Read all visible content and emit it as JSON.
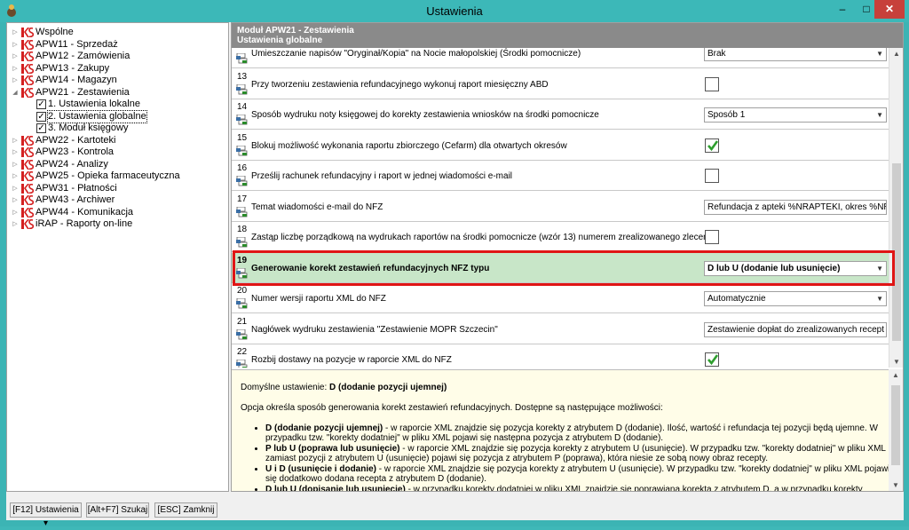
{
  "window": {
    "title": "Ustawienia",
    "minimize": "–",
    "maximize": "□",
    "close": "✕"
  },
  "tree": {
    "items": [
      {
        "label": "Wspólne",
        "type": "ks",
        "expanded": false
      },
      {
        "label": "APW11 - Sprzedaż",
        "type": "ks",
        "expanded": false
      },
      {
        "label": "APW12 - Zamówienia",
        "type": "ks",
        "expanded": false
      },
      {
        "label": "APW13 - Zakupy",
        "type": "ks",
        "expanded": false
      },
      {
        "label": "APW14 - Magazyn",
        "type": "ks",
        "expanded": false
      },
      {
        "label": "APW21 - Zestawienia",
        "type": "ks",
        "expanded": true
      },
      {
        "label": "1. Ustawienia lokalne",
        "type": "chk",
        "child": true
      },
      {
        "label": "2. Ustawienia globalne",
        "type": "chk",
        "child": true,
        "selected": true
      },
      {
        "label": "3. Moduł księgowy",
        "type": "chk",
        "child": true
      },
      {
        "label": "APW22 - Kartoteki",
        "type": "ks",
        "expanded": false
      },
      {
        "label": "APW23 - Kontrola",
        "type": "ks",
        "expanded": false
      },
      {
        "label": "APW24 - Analizy",
        "type": "ks",
        "expanded": false
      },
      {
        "label": "APW25 - Opieka farmaceutyczna",
        "type": "ks",
        "expanded": false
      },
      {
        "label": "APW31 - Płatności",
        "type": "ks",
        "expanded": false
      },
      {
        "label": "APW43 - Archiwer",
        "type": "ks",
        "expanded": false
      },
      {
        "label": "APW44 - Komunikacja",
        "type": "ks",
        "expanded": false
      },
      {
        "label": "iRAP - Raporty on-line",
        "type": "ks",
        "expanded": false
      }
    ]
  },
  "header": {
    "module": "Moduł APW21 - Zestawienia",
    "section": "Ustawienia globalne"
  },
  "rows": [
    {
      "num": "",
      "label": "Umieszczanie napisów \"Oryginał/Kopia\" na Nocie małopolskiej (Środki pomocnicze)",
      "control": "select",
      "value": "Brak"
    },
    {
      "num": "13",
      "label": "Przy tworzeniu zestawienia refundacyjnego wykonuj raport miesięczny ABD",
      "control": "checkbox",
      "checked": false
    },
    {
      "num": "14",
      "label": "Sposób wydruku noty księgowej do korekty zestawienia wniosków na środki pomocnicze",
      "control": "select",
      "value": "Sposób 1"
    },
    {
      "num": "15",
      "label": "Blokuj możliwość wykonania raportu zbiorczego (Cefarm) dla otwartych okresów",
      "control": "checkbox",
      "checked": true
    },
    {
      "num": "16",
      "label": "Prześlij rachunek refundacyjny i raport w jednej wiadomości e-mail",
      "control": "checkbox",
      "checked": false
    },
    {
      "num": "17",
      "label": "Temat wiadomości e-mail do NFZ",
      "control": "text",
      "value": "Refundacja z apteki %NRAPTEKI, okres %NROKRES"
    },
    {
      "num": "18",
      "label": "Zastąp liczbę porządkową na wydrukach raportów na środki pomocnicze (wzór 13) numerem zrealizowanego zlecenia",
      "control": "checkbox",
      "checked": false
    },
    {
      "num": "19",
      "label": "Generowanie korekt zestawień refundacyjnych NFZ typu",
      "control": "select",
      "value": "D lub U (dodanie lub usunięcie)",
      "highlight": true
    },
    {
      "num": "20",
      "label": "Numer wersji raportu XML do NFZ",
      "control": "select",
      "value": "Automatycznie"
    },
    {
      "num": "21",
      "label": "Nagłówek wydruku zestawienia \"Zestawienie MOPR Szczecin\"",
      "control": "text",
      "value": "Zestawienie dopłat do zrealizowanych recept dla pe"
    },
    {
      "num": "22",
      "label": "Rozbij dostawy na pozycje w raporcie XML do NFZ",
      "control": "checkbox",
      "checked": true
    }
  ],
  "description": {
    "default_prefix": "Domyślne ustawienie: ",
    "default_value": "D (dodanie pozycji ujemnej)",
    "intro": "Opcja określa sposób generowania korekt zestawień refundacyjnych. Dostępne są następujące możliwości:",
    "options": [
      {
        "term": "D (dodanie pozycji ujemnej)",
        "text": " - w raporcie XML znajdzie się pozycja korekty z atrybutem D (dodanie). Ilość, wartość i refundacja tej pozycji będą ujemne. W przypadku tzw. \"korekty dodatniej\" w pliku XML pojawi się następna pozycja z atrybutem D (dodanie)."
      },
      {
        "term": "P lub U (poprawa lub usunięcie)",
        "text": " - w raporcie XML znajdzie się pozycja korekty z atrybutem U (usunięcie). W przypadku tzw. \"korekty dodatniej\" w pliku XML zamiast pozycji z atrybutem U (usunięcie) pojawi się pozycja z atrybutem P (poprawa), która niesie ze sobą nowy obraz recepty."
      },
      {
        "term": "U i D (usunięcie i dodanie)",
        "text": " - w raporcie XML znajdzie się pozycja korekty z atrybutem U (usunięcie). W przypadku tzw. \"korekty dodatniej\" w pliku XML pojawi się dodatkowo dodana recepta z atrybutem D (dodanie)."
      },
      {
        "term": "D lub U (dopisanie lub usunięcie)",
        "text": " - w przypadku korekty dodatniej w pliku XML znajdzie się poprawiana korekta z atrybutem D, a w przypadku korekty ujemnej zostanie przekazana pozycja z atrybutem U."
      }
    ]
  },
  "buttons": {
    "settings": "[F12] Ustawienia",
    "search": "[Alt+F7] Szukaj",
    "close": "[ESC] Zamknij"
  },
  "colors": {
    "highlight_row": "#c8e6c8",
    "red_frame": "#e01515",
    "title_bar": "#3cb8b8",
    "header": "#8a8a8a",
    "desc_bg": "#fffde8",
    "check_green": "#2e9e2e"
  }
}
